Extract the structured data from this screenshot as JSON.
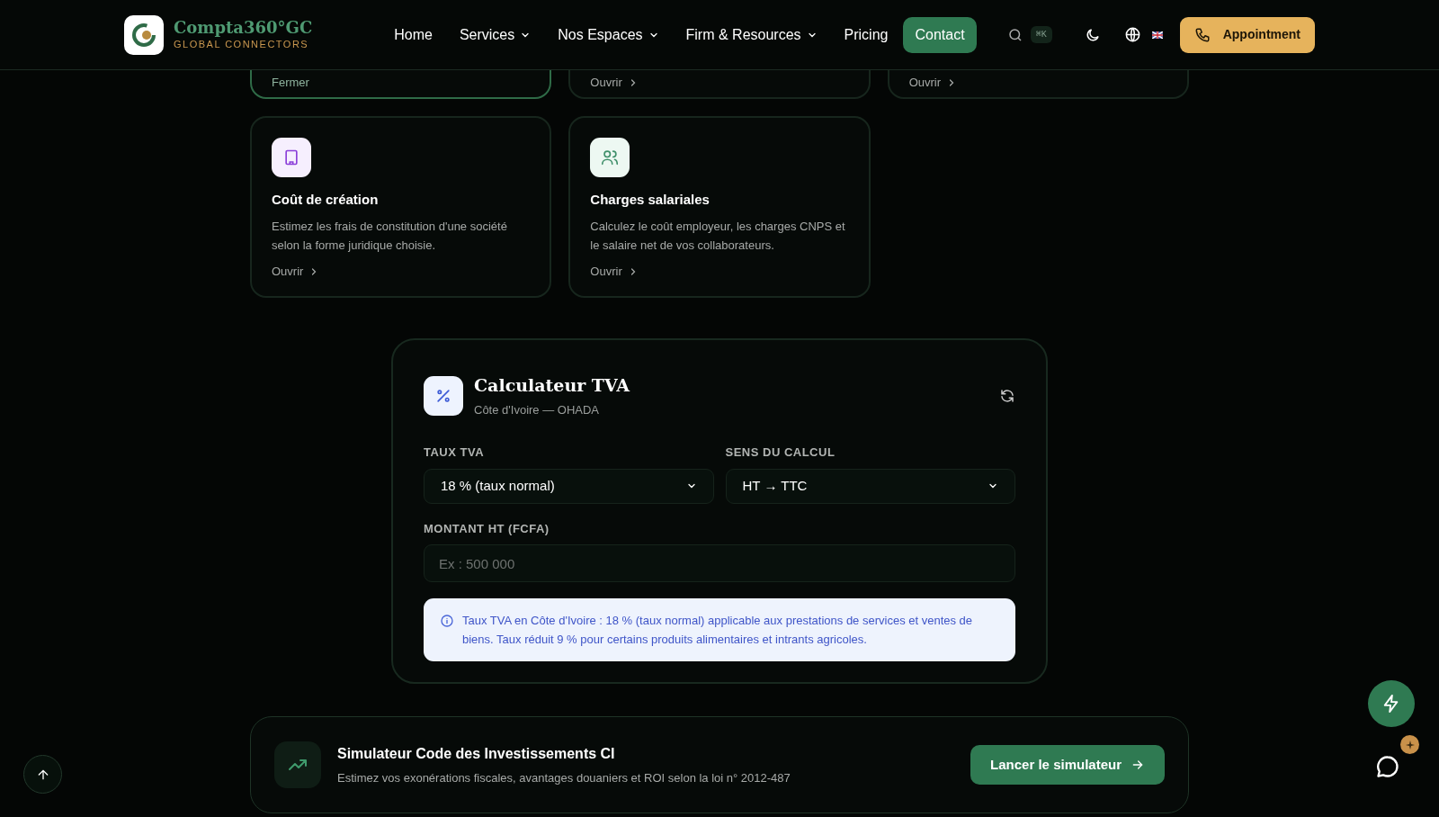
{
  "header": {
    "brand": {
      "name": "Compta360°GC",
      "tagline": "GLOBAL CONNECTORS"
    },
    "nav": [
      {
        "label": "Home",
        "dropdown": false,
        "selected": false
      },
      {
        "label": "Services",
        "dropdown": true,
        "selected": false
      },
      {
        "label": "Nos Espaces",
        "dropdown": true,
        "selected": false
      },
      {
        "label": "Firm & Resources",
        "dropdown": true,
        "selected": false
      },
      {
        "label": "Pricing",
        "dropdown": false,
        "selected": false
      },
      {
        "label": "Contact",
        "dropdown": false,
        "selected": true
      }
    ],
    "search_shortcut": "⌘K",
    "appointment_button": "Appointment"
  },
  "tool_cards": [
    {
      "link": "Fermer",
      "selected": true
    },
    {
      "link": "Ouvrir",
      "selected": false
    },
    {
      "link": "Ouvrir",
      "selected": false
    },
    {
      "title": "Coût de création",
      "description": "Estimez les frais de constitution d'une société selon la forme juridique choisie.",
      "link": "Ouvrir",
      "selected": false
    },
    {
      "title": "Charges salariales",
      "description": "Calculez le coût employeur, les charges CNPS et le salaire net de vos collaborateurs.",
      "link": "Ouvrir",
      "selected": false
    }
  ],
  "calculator": {
    "title": "Calculateur TVA",
    "subtitle": "Côte d'Ivoire — OHADA",
    "fields": [
      {
        "kind": "select",
        "label": "TAUX TVA",
        "value": "18 % (taux normal)"
      },
      {
        "kind": "select",
        "label": "SENS DU CALCUL",
        "value": "HT → TTC"
      },
      {
        "kind": "input",
        "label": "MONTANT HT (FCFA)",
        "placeholder": "Ex : 500 000"
      }
    ],
    "info": "Taux TVA en Côte d'Ivoire : 18 % (taux normal) applicable aux prestations de services et ventes de biens. Taux réduit 9 % pour certains produits alimentaires et intrants agricoles."
  },
  "banner": {
    "title": "Simulateur Code des Investissements CI",
    "description": "Estimez vos exonérations fiscales, avantages douaniers et ROI selon la loi n° 2012-487",
    "button": "Lancer le simulateur"
  }
}
